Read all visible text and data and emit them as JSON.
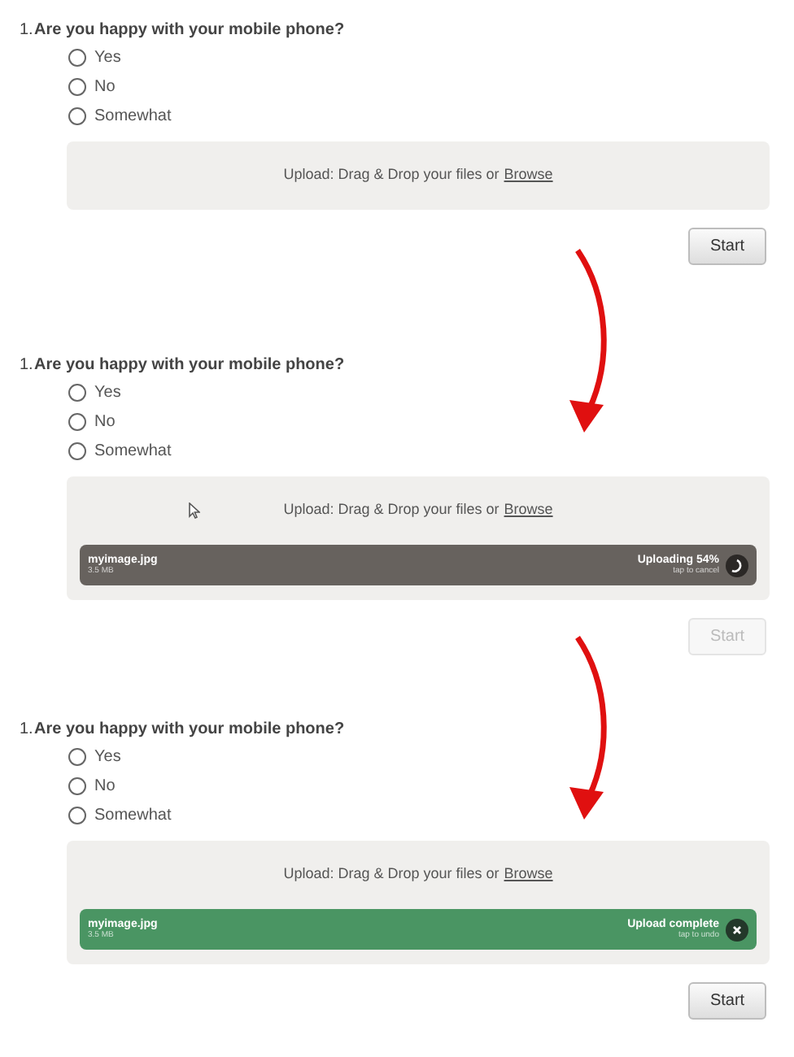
{
  "panels": [
    {
      "number": "1.",
      "question": "Are you happy with your mobile phone?",
      "options": [
        {
          "label": "Yes",
          "selected": false
        },
        {
          "label": "No",
          "selected": false
        },
        {
          "label": "Somewhat",
          "selected": false
        }
      ],
      "upload": {
        "prompt": "Upload: Drag & Drop your files or",
        "link": "Browse"
      },
      "start": {
        "label": "Start",
        "disabled": false
      }
    },
    {
      "number": "1.",
      "question": "Are you happy with your mobile phone?",
      "options": [
        {
          "label": "Yes",
          "selected": false
        },
        {
          "label": "No",
          "selected": false
        },
        {
          "label": "Somewhat",
          "selected": false
        }
      ],
      "upload": {
        "prompt": "Upload: Drag & Drop your files or",
        "link": "Browse",
        "file": {
          "kind": "uploading",
          "name": "myimage.jpg",
          "size": "3.5 MB",
          "status": "Uploading 54%",
          "hint": "tap to cancel"
        }
      },
      "start": {
        "label": "Start",
        "disabled": true
      }
    },
    {
      "number": "1.",
      "question": "Are you happy with your mobile phone?",
      "options": [
        {
          "label": "Yes",
          "selected": false
        },
        {
          "label": "No",
          "selected": false
        },
        {
          "label": "Somewhat",
          "selected": false
        }
      ],
      "upload": {
        "prompt": "Upload: Drag & Drop your files or",
        "link": "Browse",
        "file": {
          "kind": "complete",
          "name": "myimage.jpg",
          "size": "3.5 MB",
          "status": "Upload complete",
          "hint": "tap to undo"
        }
      },
      "start": {
        "label": "Start",
        "disabled": false
      }
    }
  ]
}
